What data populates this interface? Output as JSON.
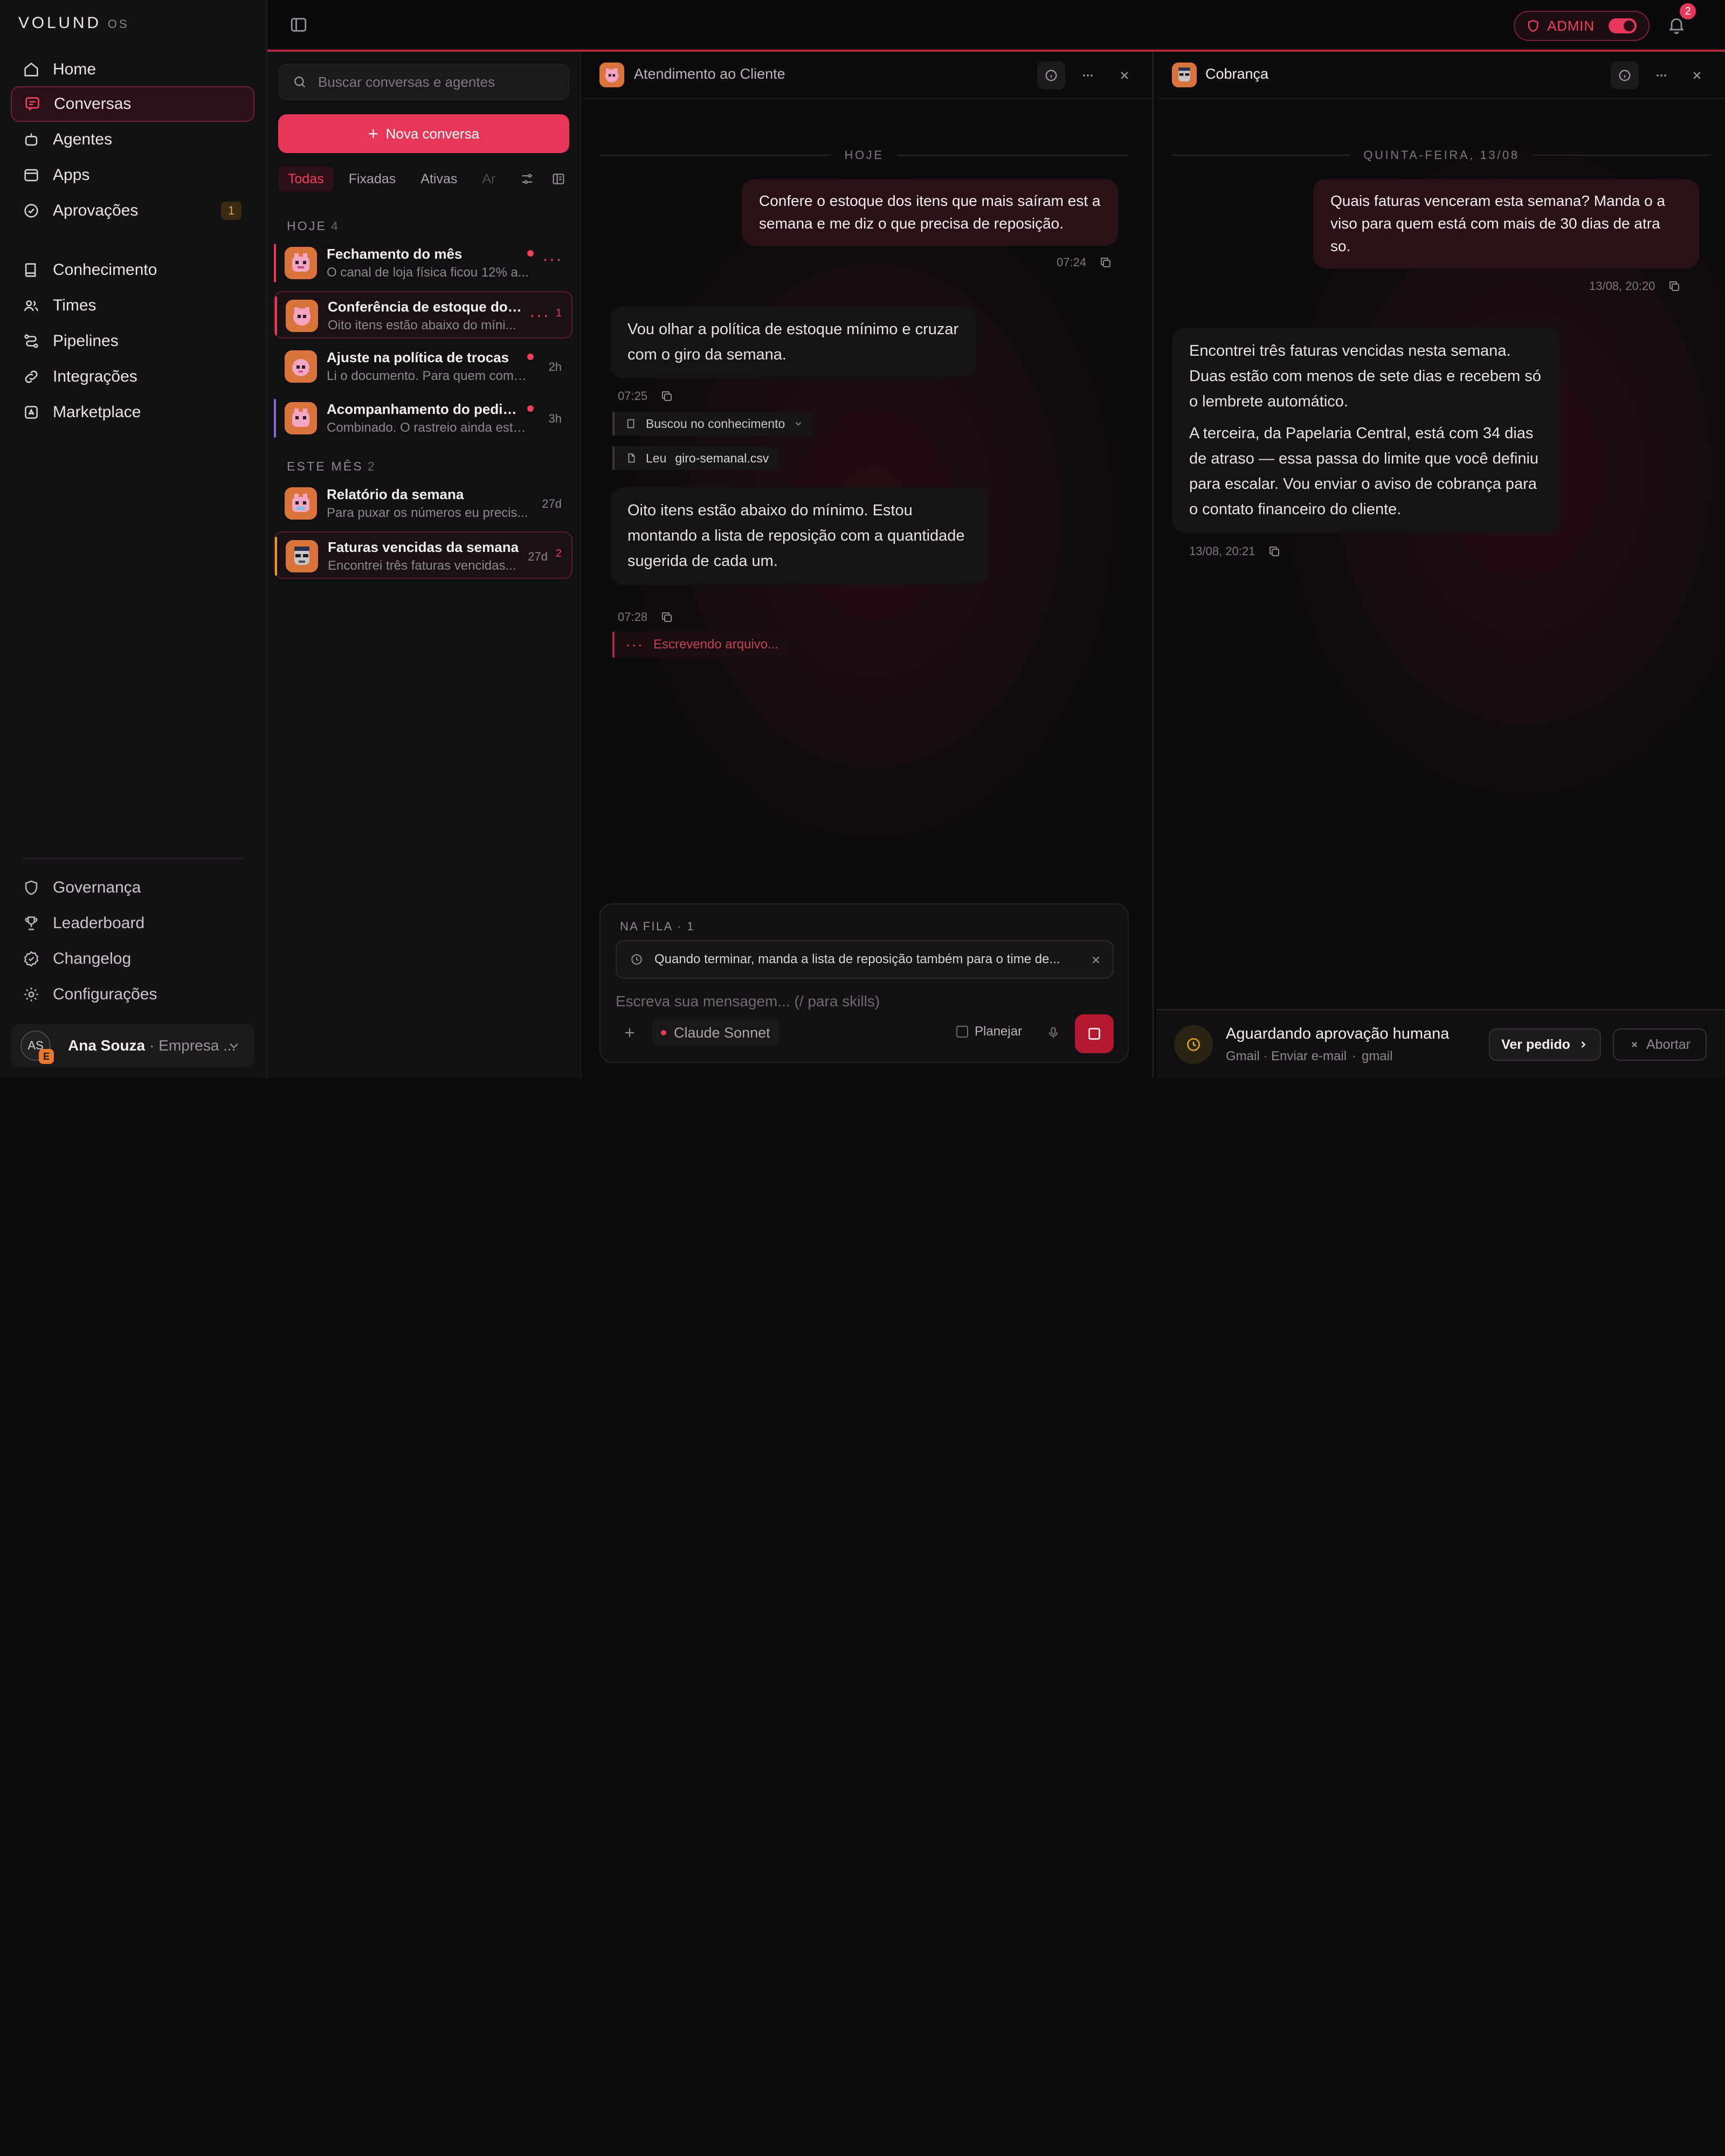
{
  "brand": {
    "name": "VOLUND",
    "suffix": "OS"
  },
  "nav": {
    "items": [
      {
        "label": "Home",
        "icon": "home-icon"
      },
      {
        "label": "Conversas",
        "icon": "chat-icon",
        "active": true
      },
      {
        "label": "Agentes",
        "icon": "bot-icon"
      },
      {
        "label": "Apps",
        "icon": "apps-icon"
      },
      {
        "label": "Aprovações",
        "icon": "check-circle-icon",
        "badge": "1"
      },
      {
        "label": "Conhecimento",
        "icon": "book-icon"
      },
      {
        "label": "Times",
        "icon": "users-icon"
      },
      {
        "label": "Pipelines",
        "icon": "pipeline-icon"
      },
      {
        "label": "Integrações",
        "icon": "link-icon"
      },
      {
        "label": "Marketplace",
        "icon": "store-icon"
      }
    ],
    "bottom": [
      {
        "label": "Governança",
        "icon": "shield-icon"
      },
      {
        "label": "Leaderboard",
        "icon": "trophy-icon"
      },
      {
        "label": "Changelog",
        "icon": "badge-icon"
      },
      {
        "label": "Configurações",
        "icon": "gear-icon"
      }
    ],
    "user": {
      "initials": "AS",
      "org_badge": "E",
      "name": "Ana Souza",
      "org": "· Empresa ..."
    }
  },
  "topbar": {
    "admin_label": "ADMIN",
    "notifications": "2"
  },
  "list": {
    "search_placeholder": "Buscar conversas e agentes",
    "new_button": "Nova conversa",
    "filters": [
      "Todas",
      "Fixadas",
      "Ativas",
      "Ar"
    ],
    "sections": [
      {
        "title": "HOJE",
        "count": "4"
      },
      {
        "title": "ESTE MÊS",
        "count": "2"
      }
    ],
    "conversations": [
      {
        "title": "Fechamento do mês",
        "preview": "O canal de loja física ficou 12% a...",
        "time": "",
        "accent": "#e8385a",
        "unread_dot": true,
        "typing": true,
        "count": ""
      },
      {
        "title": "Conferência de estoque do ...",
        "preview": "Oito itens estão abaixo do míni...",
        "time": "",
        "accent": "#e8385a",
        "unread_dot": false,
        "typing": true,
        "count": "1",
        "selected": true
      },
      {
        "title": "Ajuste na política de trocas",
        "preview": "Li o documento. Para quem comp...",
        "time": "2h",
        "accent": "",
        "unread_dot": true,
        "typing": false,
        "count": ""
      },
      {
        "title": "Acompanhamento do pedido...",
        "preview": "Combinado. O rastreio ainda está ...",
        "time": "3h",
        "accent": "#8a6ad9",
        "unread_dot": true,
        "typing": false,
        "count": ""
      },
      {
        "title": "Relatório da semana",
        "preview": "Para puxar os números eu precis...",
        "time": "27d",
        "accent": "",
        "unread_dot": false,
        "typing": false,
        "count": ""
      },
      {
        "title": "Faturas vencidas da semana",
        "preview": "Encontrei três faturas vencidas...",
        "time": "27d",
        "accent": "#e0a020",
        "unread_dot": false,
        "typing": false,
        "count": "2",
        "selected": true
      }
    ]
  },
  "pane1": {
    "title": "Atendimento ao Cliente",
    "day": "HOJE",
    "user_msg": "Confere o estoque dos itens que mais saíram est a semana e me diz o que precisa de reposição.",
    "user_time": "07:24",
    "agent_msg1": "Vou olhar a política de estoque mínimo e cruzar com o giro da semana.",
    "agent_time1": "07:25",
    "tool1": "Buscou no conhecimento",
    "tool2_label": "Leu",
    "tool2_file": "giro-semanal.csv",
    "agent_msg2": "Oito itens estão abaixo do mínimo. Estou montando a lista de reposição com a quantidade sugerida de cada um.",
    "agent_time2": "07:28",
    "writing": "Escrevendo arquivo...",
    "composer": {
      "queue_header": "NA FILA · 1",
      "queue_item": "Quando terminar, manda a lista de reposição também para o time de...",
      "placeholder": "Escreva sua mensagem... (/ para skills)",
      "model": "Claude Sonnet",
      "plan": "Planejar"
    }
  },
  "pane2": {
    "title": "Cobrança",
    "day": "QUINTA-FEIRA, 13/08",
    "user_msg": "Quais faturas venceram esta semana? Manda o a viso para quem está com mais de 30 dias de atra so.",
    "user_time": "13/08, 20:20",
    "agent_p1": "Encontrei três faturas vencidas nesta semana. Duas estão com menos de sete dias e recebem só o lembrete automático.",
    "agent_p2": "A terceira, da Papelaria Central, está com 34 dias de atraso — essa passa do limite que você definiu para escalar. Vou enviar o aviso de cobrança para o contato financeiro do cliente.",
    "agent_time": "13/08, 20:21",
    "approval": {
      "title": "Aguardando aprovação humana",
      "sub1": "Gmail · Enviar e-mail",
      "sub2": "gmail",
      "view": "Ver pedido",
      "abort": "Abortar"
    }
  }
}
